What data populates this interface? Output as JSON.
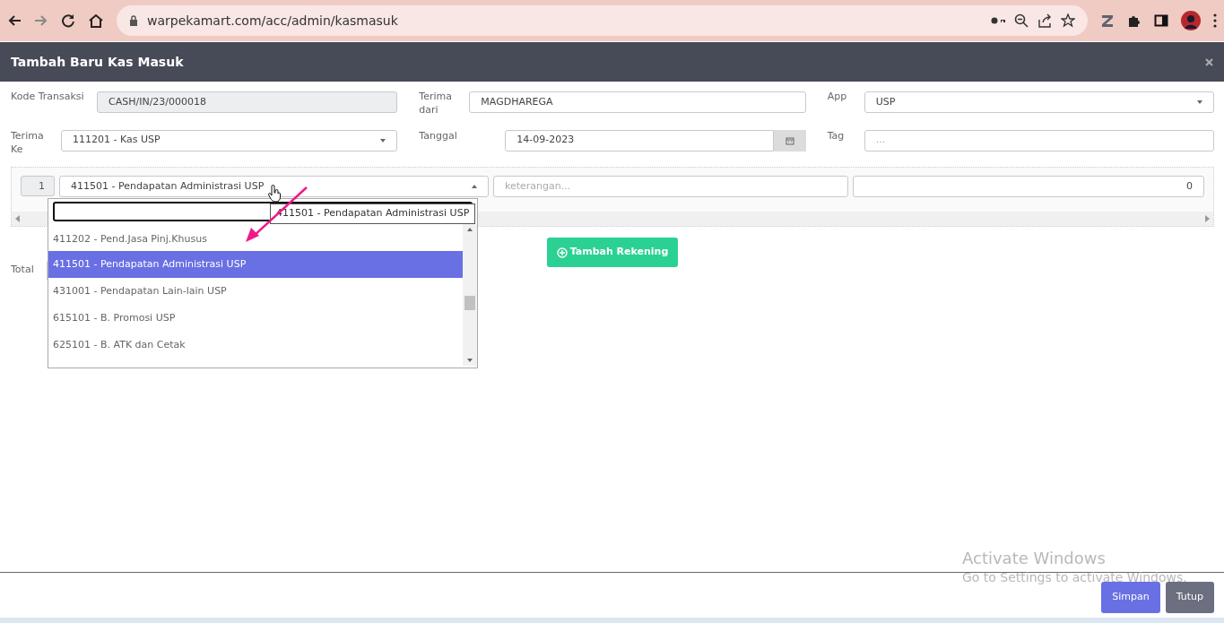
{
  "browser": {
    "url": "warpekamart.com/acc/admin/kasmasuk"
  },
  "modal": {
    "title": "Tambah Baru Kas Masuk"
  },
  "fields": [
    {
      "kind": "input",
      "label": "Kode Transaksi",
      "value": "CASH/IN/23/000018",
      "disabled": true
    },
    {
      "kind": "input",
      "label": "Terima dari",
      "value": "MAGDHAREGA",
      "disabled": false
    },
    {
      "kind": "select",
      "label": "App",
      "value": "USP",
      "disabled": false
    },
    {
      "kind": "select",
      "label": "Terima Ke",
      "value": "111201 - Kas USP",
      "disabled": false
    },
    {
      "kind": "date",
      "label": "Tanggal",
      "value": "14-09-2023",
      "disabled": false
    },
    {
      "kind": "input",
      "label": "Tag",
      "placeholder": "...",
      "disabled": false
    }
  ],
  "lines": [
    {
      "number": "1",
      "account": "411501 - Pendapatan Administrasi USP",
      "description_placeholder": "keterangan...",
      "amount": "0"
    }
  ],
  "account_dropdown": {
    "expanded": true,
    "tooltip": "411501 - Pendapatan Administrasi USP",
    "options": [
      {
        "label": "411202 - Pend.Jasa Pinj.Khusus",
        "selected": false
      },
      {
        "label": "411501 - Pendapatan Administrasi USP",
        "selected": true
      },
      {
        "label": "431001 - Pendapatan Lain-lain USP",
        "selected": false
      },
      {
        "label": "615101 - B. Promosi USP",
        "selected": false
      },
      {
        "label": "625101 - B. ATK dan Cetak",
        "selected": false
      }
    ]
  },
  "add_account_button": "Tambah Rekening",
  "total": {
    "label": "Total"
  },
  "footer_buttons": [
    {
      "kind": "primary",
      "label": "Simpan"
    },
    {
      "kind": "secondary",
      "label": "Tutup"
    }
  ],
  "os_notice": {
    "title": "Activate Windows",
    "subtitle": "Go to Settings to activate Windows."
  }
}
